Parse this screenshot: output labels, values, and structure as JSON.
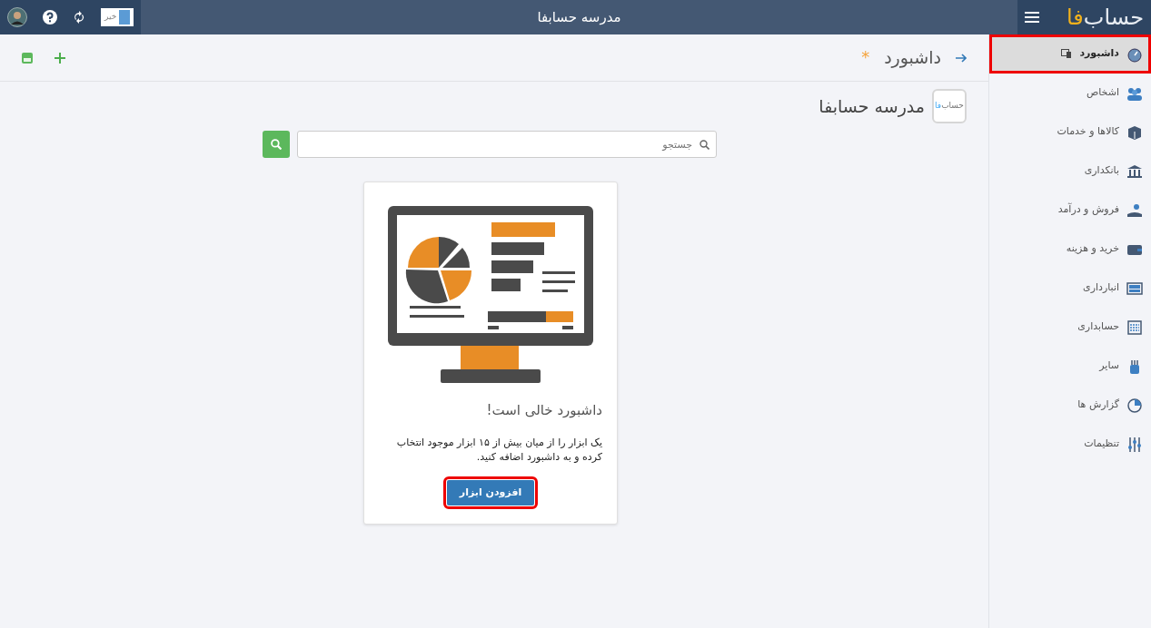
{
  "topbar": {
    "logo": {
      "main": "حساب",
      "accent": "فا"
    },
    "title": "مدرسه حسابفا",
    "user_chip": "خیر"
  },
  "sidebar": {
    "items": [
      {
        "label": "داشبورد",
        "selected": true,
        "highlighted": true
      },
      {
        "label": "اشخاص",
        "selected": false,
        "highlighted": false
      },
      {
        "label": "کالاها و خدمات",
        "selected": false,
        "highlighted": false
      },
      {
        "label": "بانکداری",
        "selected": false,
        "highlighted": false
      },
      {
        "label": "فروش و درآمد",
        "selected": false,
        "highlighted": false
      },
      {
        "label": "خرید و هزینه",
        "selected": false,
        "highlighted": false
      },
      {
        "label": "انبارداری",
        "selected": false,
        "highlighted": false
      },
      {
        "label": "حسابداری",
        "selected": false,
        "highlighted": false
      },
      {
        "label": "سایر",
        "selected": false,
        "highlighted": false
      },
      {
        "label": "گزارش ها",
        "selected": false,
        "highlighted": false
      },
      {
        "label": "تنظیمات",
        "selected": false,
        "highlighted": false
      }
    ]
  },
  "page": {
    "title": "داشبورد",
    "unsaved_mark": "*",
    "business": {
      "logo_text": "حساب",
      "logo_accent": "فا",
      "name": "مدرسه حسابفا"
    },
    "search": {
      "placeholder": "جستجو"
    },
    "empty_card": {
      "heading": "داشبورد خالی است!",
      "text": "یک ابزار را از میان بیش از ۱۵ ابزار موجود انتخاب کرده و به داشبورد اضافه کنید.",
      "button": {
        "label": "افزودن ابزار",
        "highlighted": true
      }
    }
  }
}
